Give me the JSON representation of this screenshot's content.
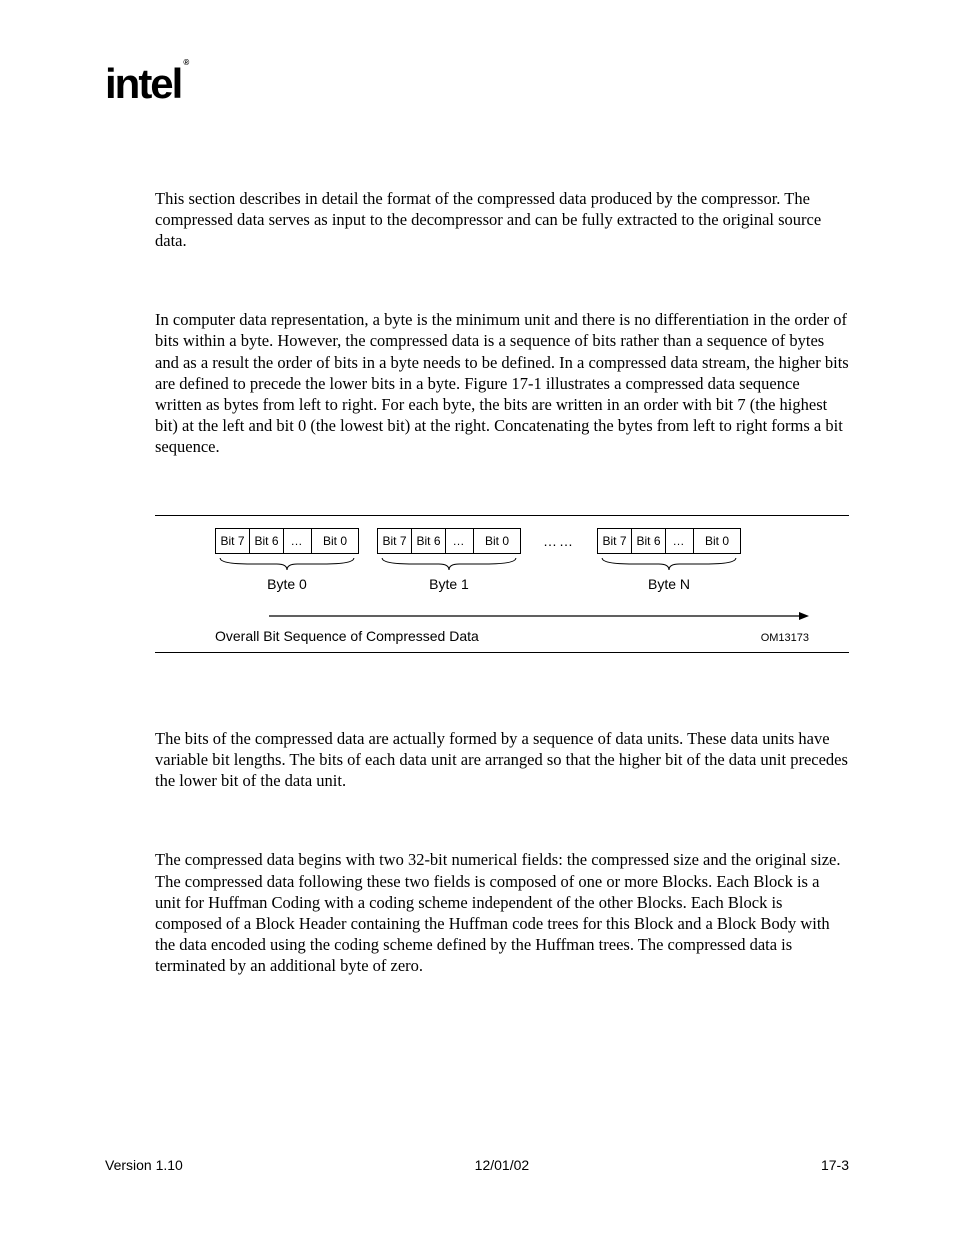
{
  "logo": {
    "text": "intel",
    "mark": "®"
  },
  "paragraphs": {
    "p1": "This section describes in detail the format of the compressed data produced by the compressor.  The compressed data serves as input to the decompressor and can be fully extracted to the original source data.",
    "p2": "In computer data representation, a byte is the minimum unit and there is no differentiation in the order of bits within a byte.  However, the compressed data is a sequence of bits rather than a sequence of bytes and as a result the order of bits in a byte needs to be defined.  In a compressed data stream, the higher bits are defined to precede the lower bits in a byte.  Figure 17-1 illustrates a compressed data sequence written as bytes from left to right.  For each byte, the bits are written in an order with bit 7 (the highest bit) at the left and bit 0 (the lowest bit) at the right.  Concatenating the bytes from left to right forms a bit sequence.",
    "p3": "The bits of the compressed data are actually formed by a sequence of data units.  These data units have variable bit lengths.  The bits of each data unit are arranged so that the higher bit of the data unit precedes the lower bit of the data unit.",
    "p4": "The compressed data begins with two 32-bit numerical fields: the compressed size and the original size.  The compressed data following these two fields is composed of one or more Blocks.  Each Block is a unit for Huffman Coding with a coding scheme independent of the other Blocks.  Each Block is composed of a Block Header containing the Huffman code trees for this Block and a Block Body with the data encoded using the coding scheme defined by the Huffman trees.  The compressed data is terminated by an additional byte of zero."
  },
  "figure": {
    "bits": {
      "bit7": "Bit 7",
      "bit6": "Bit 6",
      "dots": "…",
      "bit0": "Bit 0"
    },
    "byteLabels": {
      "b0": "Byte 0",
      "b1": "Byte 1",
      "bn": "Byte N"
    },
    "interDots": "……",
    "caption": "Overall Bit Sequence of Compressed Data",
    "code": "OM13173"
  },
  "footer": {
    "version": "Version 1.10",
    "date": "12/01/02",
    "page": "17-3"
  }
}
